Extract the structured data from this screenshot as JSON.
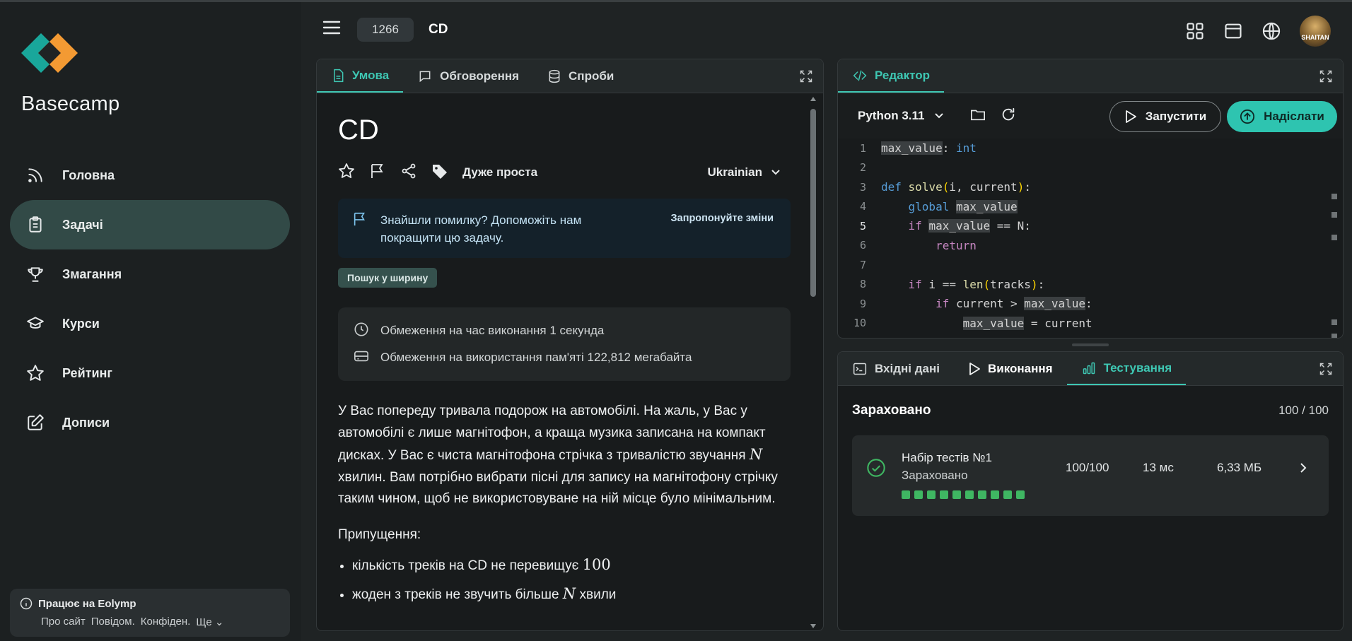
{
  "app": {
    "brand": "Basecamp"
  },
  "topbar": {
    "problem_id": "1266",
    "problem_title": "CD"
  },
  "sidebar": {
    "items": [
      {
        "label": "Головна",
        "icon": "rss-icon"
      },
      {
        "label": "Задачі",
        "icon": "clipboard-icon",
        "active": true
      },
      {
        "label": "Змагання",
        "icon": "trophy-icon"
      },
      {
        "label": "Курси",
        "icon": "graduation-cap-icon"
      },
      {
        "label": "Рейтинг",
        "icon": "star-icon"
      },
      {
        "label": "Дописи",
        "icon": "edit-icon"
      }
    ],
    "footer": {
      "title": "Працює на Eolymp",
      "links": [
        "Про сайт",
        "Повідом.",
        "Конфіден.",
        "Ще"
      ]
    }
  },
  "problem_panel": {
    "tabs": [
      {
        "label": "Умова",
        "active": true
      },
      {
        "label": "Обговорення"
      },
      {
        "label": "Спроби"
      }
    ],
    "title": "CD",
    "difficulty": "Дуже проста",
    "language": "Ukrainian",
    "notice": {
      "message": "Знайшли помилку? Допоможіть нам покращити цю задачу.",
      "action": "Запропонуйте зміни"
    },
    "tag": "Пошук у ширину",
    "limits": {
      "time": "Обмеження на час виконання 1 секунда",
      "memory": "Обмеження на використання пам'яті 122,812 мегабайта"
    },
    "statement": {
      "p1_before": "У Вас попереду тривала подорож на автомобілі. На жаль, у Вас у автомобілі є лише магнітофон, а краща музика записана на компакт дисках. У Вас є чиста магнітофона стрічка з тривалістю звучання",
      "p1_math": "N",
      "p1_after": "хвилин. Вам потрібно вибрати пісні для запису на магнітофону стрічку таким чином, щоб не використовуване на ній місце було мінімальним.",
      "assumptions_title": "Припущення:",
      "li1_text": "кількість треків на CD не перевищує",
      "li1_math": "100",
      "li2_text": "жоден з треків не звучить більше",
      "li2_math": "N",
      "li2_after": "хвили"
    }
  },
  "editor": {
    "tab": "Редактор",
    "language": "Python 3.11",
    "run_label": "Запустити",
    "submit_label": "Надіслати"
  },
  "test_panel": {
    "tabs": [
      {
        "label": "Вхідні дані"
      },
      {
        "label": "Виконання"
      },
      {
        "label": "Тестування",
        "active": true
      }
    ],
    "verdict": "Зараховано",
    "total": "100 / 100",
    "suite": {
      "name": "Набір тестів №1",
      "status": "Зараховано",
      "score": "100/100",
      "time": "13 мс",
      "memory": "6,33 МБ",
      "passed_tests": 10
    }
  },
  "colors": {
    "accent": "#3ec7b3",
    "active_nav": "#324a47",
    "pass": "#3fb662"
  }
}
